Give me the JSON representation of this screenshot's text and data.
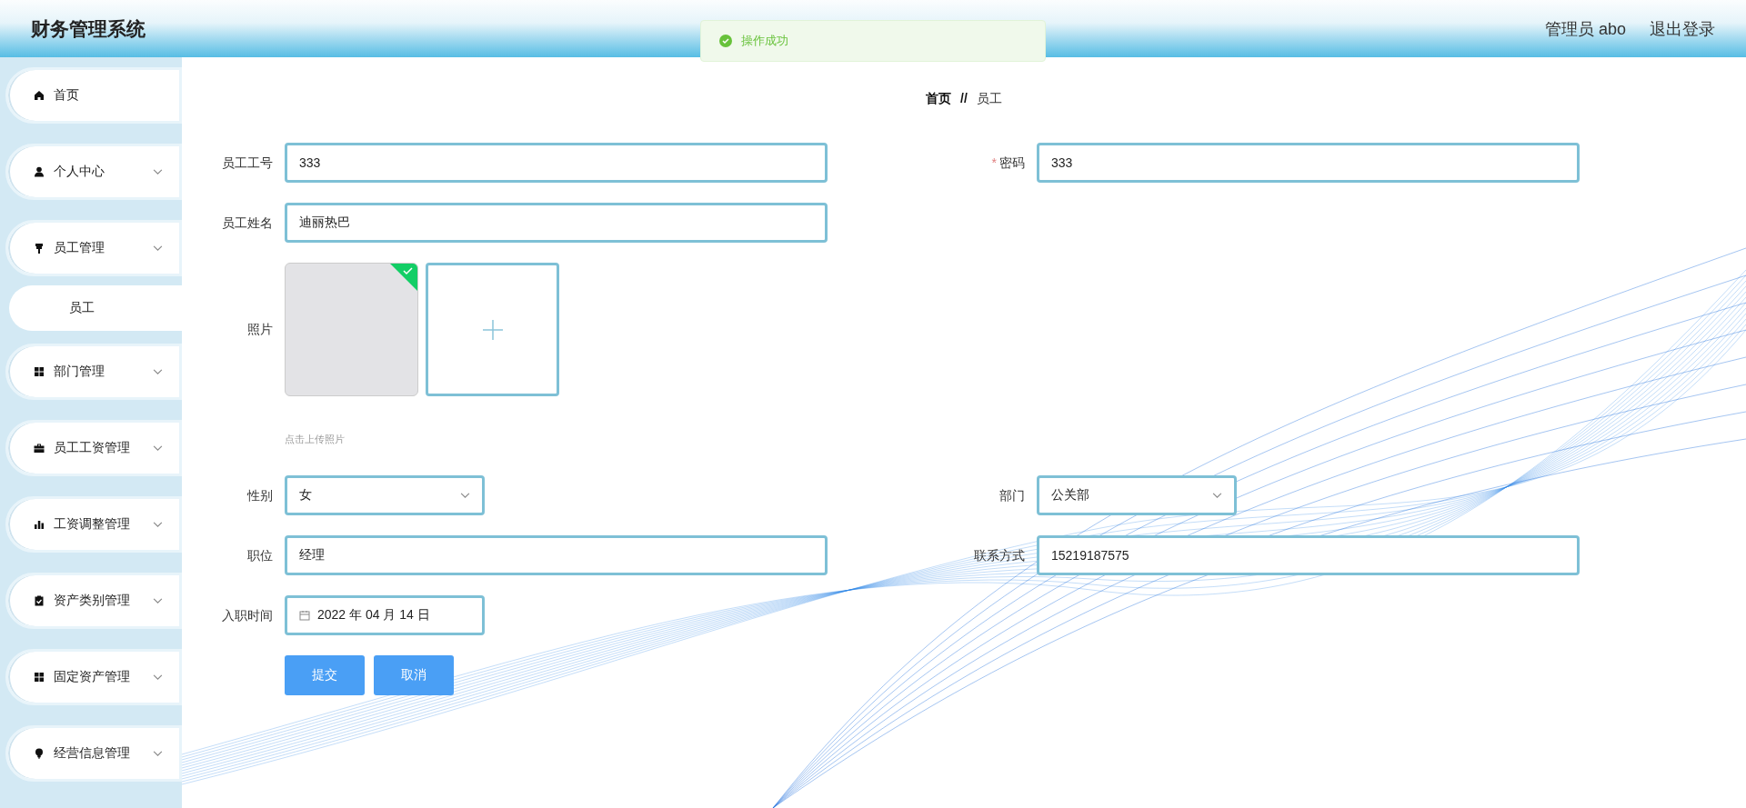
{
  "header": {
    "title": "财务管理系统",
    "user": "管理员 abo",
    "logout": "退出登录"
  },
  "toast": {
    "message": "操作成功"
  },
  "sidebar": {
    "items": [
      {
        "label": "首页",
        "has_arrow": false
      },
      {
        "label": "个人中心",
        "has_arrow": true
      },
      {
        "label": "员工管理",
        "has_arrow": true,
        "children": [
          {
            "label": "员工"
          }
        ]
      },
      {
        "label": "部门管理",
        "has_arrow": true
      },
      {
        "label": "员工工资管理",
        "has_arrow": true
      },
      {
        "label": "工资调整管理",
        "has_arrow": true
      },
      {
        "label": "资产类别管理",
        "has_arrow": true
      },
      {
        "label": "固定资产管理",
        "has_arrow": true
      },
      {
        "label": "经营信息管理",
        "has_arrow": true
      }
    ]
  },
  "breadcrumb": {
    "items": [
      "首页",
      "员工"
    ],
    "separator": "//"
  },
  "form": {
    "rows": [
      [
        {
          "kind": "input",
          "label": "员工工号",
          "value": "333"
        },
        {
          "kind": "input",
          "label": "密码",
          "required_mark": "*",
          "value": "333"
        }
      ],
      [
        {
          "kind": "input",
          "label": "员工姓名",
          "value": "迪丽热巴"
        }
      ],
      [
        {
          "kind": "photo",
          "label": "照片",
          "uploaded": true,
          "hint": "点击上传照片"
        }
      ],
      [
        {
          "kind": "select",
          "label": "性别",
          "value": "女"
        },
        {
          "kind": "select",
          "label": "部门",
          "value": "公关部"
        }
      ],
      [
        {
          "kind": "input",
          "label": "职位",
          "value": "经理"
        },
        {
          "kind": "input",
          "label": "联系方式",
          "value": "15219187575"
        }
      ],
      [
        {
          "kind": "date",
          "label": "入职时间",
          "value": "2022 年 04 月 14 日"
        }
      ]
    ],
    "buttons": [
      "提交",
      "取消"
    ]
  }
}
